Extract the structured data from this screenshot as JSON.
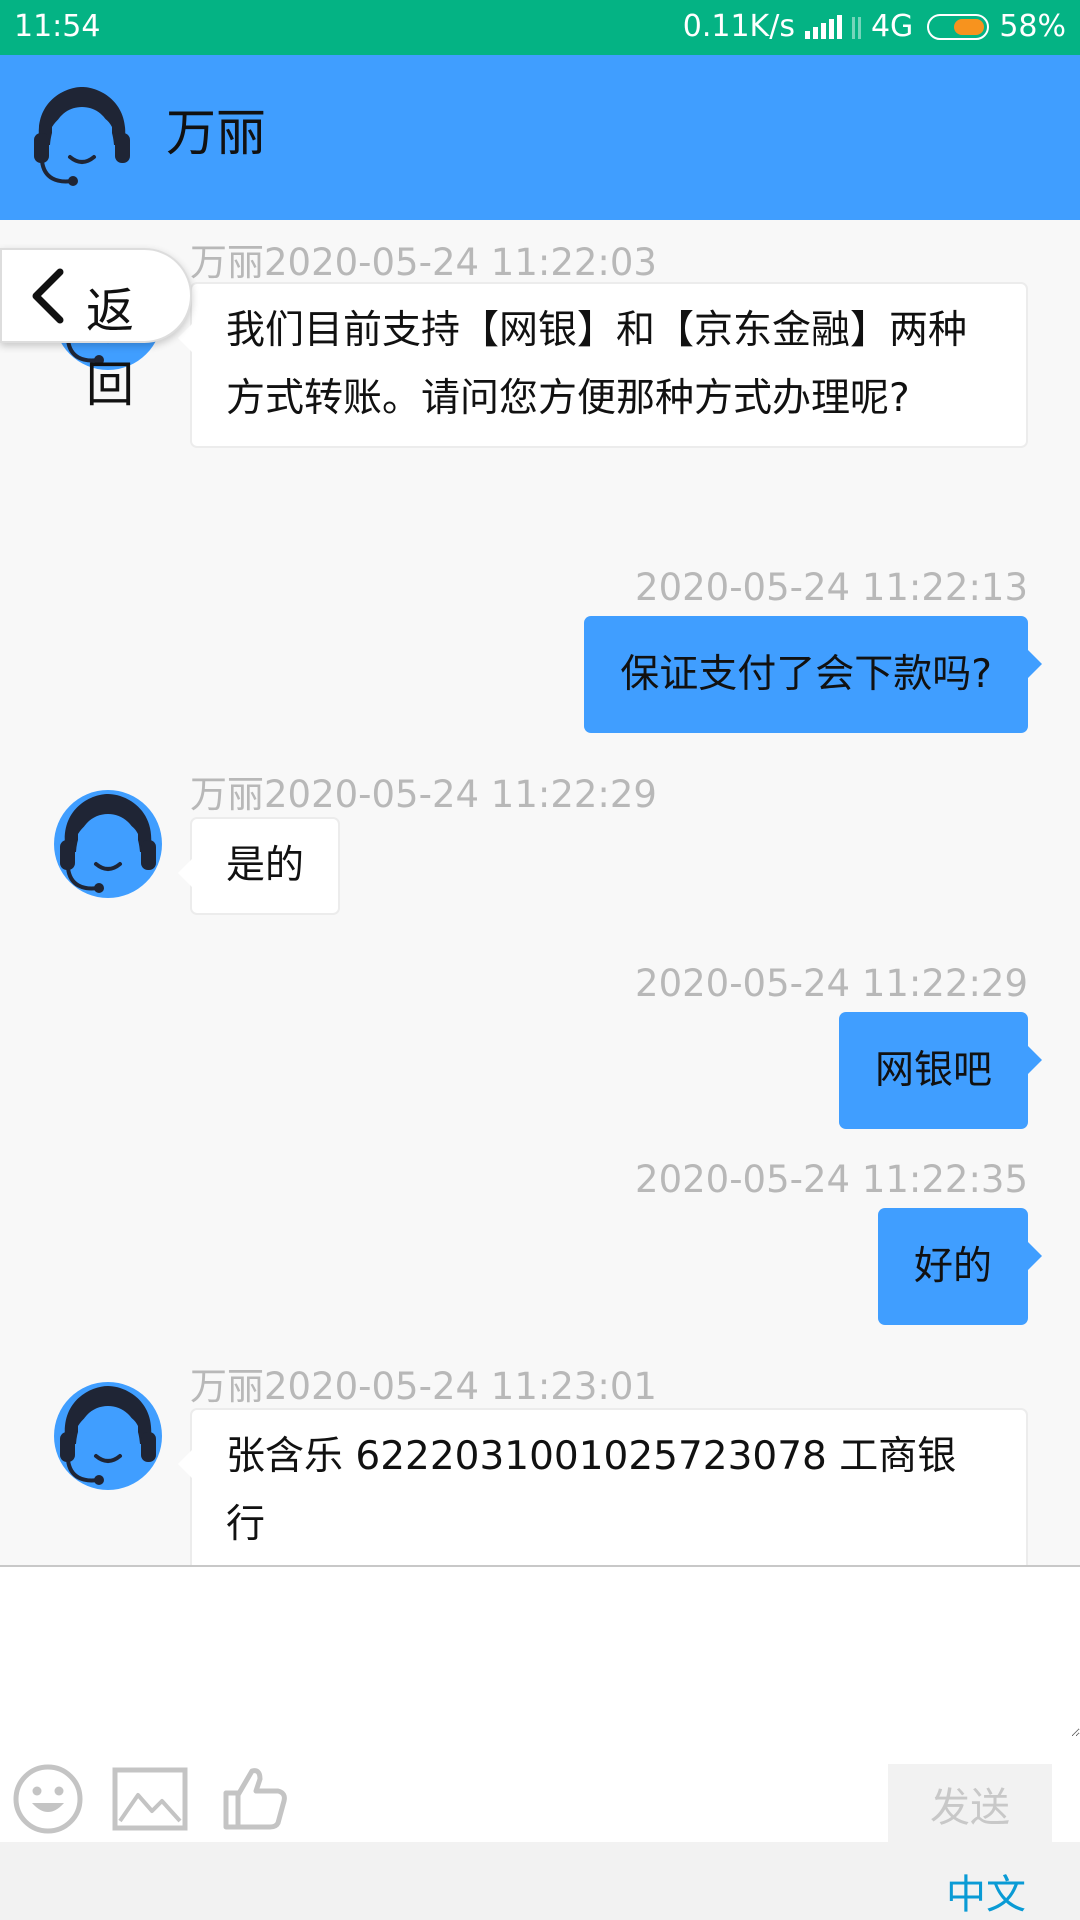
{
  "status_bar": {
    "time": "11:54",
    "speed": "0.11K/s",
    "network": "4G",
    "battery": "58%"
  },
  "header": {
    "title": "万丽",
    "avatar_icon": "agent-headset-icon"
  },
  "back_button": {
    "label": "返回",
    "icon": "chevron-left-icon"
  },
  "messages": [
    {
      "side": "left",
      "time": "万丽2020-05-24 11:22:03",
      "text": "我们目前支持【网银】和【京东金融】两种方式转账。请问您方便那种方式办理呢?"
    },
    {
      "side": "right",
      "time": "2020-05-24 11:22:13",
      "text": "保证支付了会下款吗?"
    },
    {
      "side": "left",
      "time": "万丽2020-05-24 11:22:29",
      "text": "是的"
    },
    {
      "side": "right",
      "time": "2020-05-24 11:22:29",
      "text": "网银吧"
    },
    {
      "side": "right",
      "time": "2020-05-24 11:22:35",
      "text": "好的"
    },
    {
      "side": "left",
      "time": "万丽2020-05-24 11:23:01",
      "text": "张含乐 6222031001025723078 工商银行"
    }
  ],
  "input": {
    "placeholder": "",
    "value": ""
  },
  "toolbar": {
    "emoji_icon": "smiley-icon",
    "image_icon": "image-icon",
    "like_icon": "thumbs-up-icon",
    "send_label": "发送"
  },
  "language": {
    "label": "中文"
  },
  "colors": {
    "status_bar": "#04b384",
    "header": "#409eff",
    "outgoing_bubble": "#409eff",
    "incoming_bubble": "#ffffff",
    "avatar_dark": "#1f2535"
  }
}
